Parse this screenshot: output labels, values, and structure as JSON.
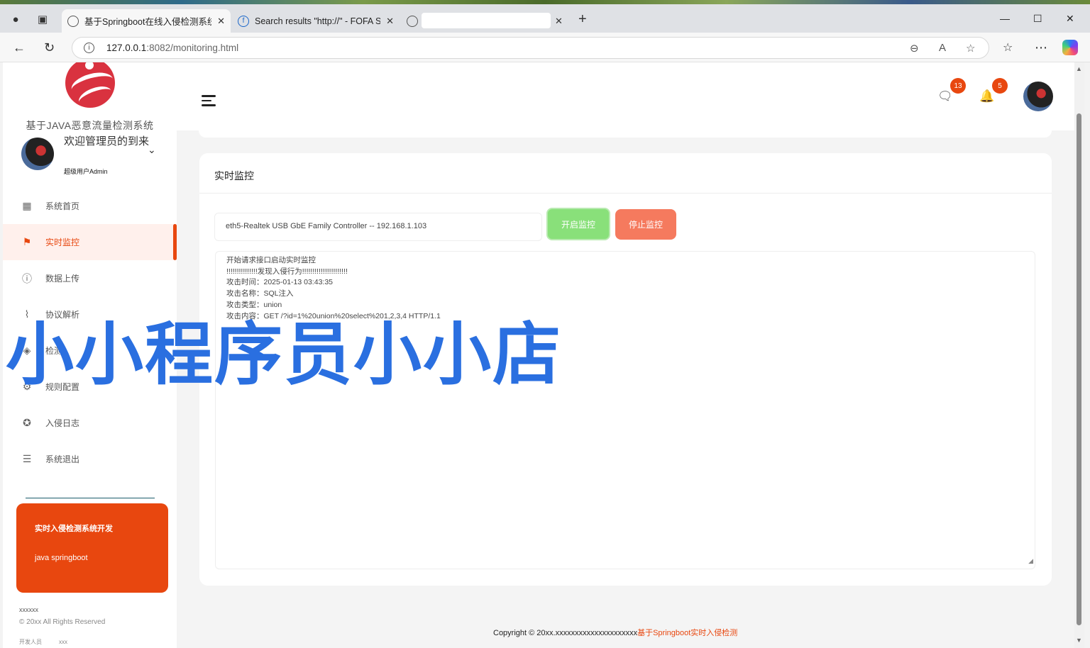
{
  "browser": {
    "tabs": [
      {
        "title": "基于Springboot在线入侵检测系统",
        "active": true
      },
      {
        "title": "Search results \"http://\" - FOFA Sea",
        "active": false
      },
      {
        "title": "",
        "active": false
      }
    ],
    "url_host": "127.0.0.1",
    "url_path": ":8082/monitoring.html"
  },
  "sidebar": {
    "brand": "基于JAVA恶意流量检测系统",
    "welcome": "欢迎管理员的到来",
    "role": "超级用户Admin",
    "menu": [
      {
        "label": "系统首页",
        "icon": "dashboard-icon"
      },
      {
        "label": "实时监控",
        "icon": "flag-icon",
        "active": true
      },
      {
        "label": "数据上传",
        "icon": "info-icon"
      },
      {
        "label": "协议解析",
        "icon": "activity-icon"
      },
      {
        "label": "检测",
        "icon": "shield-icon"
      },
      {
        "label": "规则配置",
        "icon": "settings-icon"
      },
      {
        "label": "入侵日志",
        "icon": "badge-check-icon"
      },
      {
        "label": "系统退出",
        "icon": "menu-lines-icon"
      }
    ],
    "promo": {
      "line1": "实时入侵检测系统开发",
      "line2": "java springboot"
    },
    "footer": {
      "line1": "xxxxxx",
      "line2": "© 20xx All Rights Reserved",
      "dev_label": "开发人员",
      "dev_name": "xxx"
    }
  },
  "header": {
    "messages_count": "13",
    "notifications_count": "5"
  },
  "content": {
    "title": "实时监控",
    "nic": "eth5-Realtek USB GbE Family Controller -- 192.168.1.103",
    "start_button": "开启监控",
    "stop_button": "停止监控",
    "log_lines": [
      "开始请求接口启动实时监控",
      "!!!!!!!!!!!!!!!发现入侵行为!!!!!!!!!!!!!!!!!!!!!!",
      "攻击时间：2025-01-13 03:43:35",
      "攻击名称：SQL注入",
      "攻击类型：union",
      "攻击内容：GET /?id=1%20union%20select%201,2,3,4 HTTP/1.1"
    ]
  },
  "footer": {
    "copyright": "Copyright © 20xx.xxxxxxxxxxxxxxxxxxxxx",
    "highlight": "基于Springboot实时入侵检测"
  },
  "watermark": "小小程序员小小店"
}
